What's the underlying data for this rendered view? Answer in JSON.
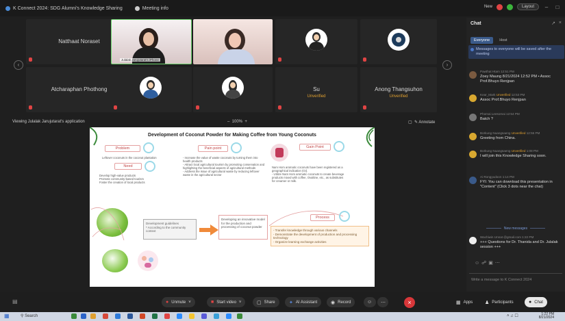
{
  "titlebar": {
    "meeting": "K Connect 2024: SDG Alumni's Knowledge Sharing",
    "info": "Meeting info",
    "new_label": "New",
    "layout_label": "Layout"
  },
  "gallery": {
    "names": {
      "t1": "Natthaat Noraset",
      "t2": "Julalak Jarujutarat's iPhone",
      "t3": "Atcharaphan Phothong",
      "t4": "Su",
      "t5": "Anong Thangsuhon"
    },
    "unverified": "Unverified"
  },
  "sharebar": {
    "viewing": "Viewing Julalak Jarujutarat's application",
    "zoom": "100%",
    "annotate": "Annotate"
  },
  "slide": {
    "title": "Development of Coconut Powder for Making Coffee from Young Coconuts",
    "problem": "Problem",
    "problem_text": "Leftover coconuts in the coconut plantation",
    "need": "Need",
    "need_text": "Develop high-value products\nPromote community-based tourism\nFoster the creation of local products",
    "pain": "Pain point",
    "pain_text": "- Increase the value of waste coconuts by turning them into health products\n- Attract local agricultural tourism by promoting conservation and highlighting the beneficial aspects of agricultural methods\n- Address the issue of agricultural waste by reducing leftover waste in the agricultural sector",
    "gain": "Gain Point",
    "gain_text": "Nam Hom aromatic coconuts have been registered as a geographical indication (GI).\n- Utilize Nam Hom aromatic coconuts to create beverage products mixed with coffee, Ovaltine, etc., as substitutes for creamer or milk.",
    "guideline": "Development guidelines\n* According to the community context",
    "model": "Developing an innovative model for the production and processing of coconut powder",
    "process": "Process",
    "process_text": "- Transfer knowledge through various channels\n- Demonstrate the development of production and processing technology\n- Organize learning exchange activities"
  },
  "chat": {
    "title": "Chat",
    "tab_everyone": "Everyone",
    "tab_host": "Host",
    "notice": "Messages to everyone will be saved after the meeting",
    "m1_meta": "Pawthat Htam 12:51 PM",
    "m1_text": "Zoey Maung 8/21/2024 12:52 PM • Assoc Prof.Bhuyo Renjpan",
    "m2_meta_name": "Kear_Mark",
    "m2_meta_time": "12:53 PM",
    "m2_text": "Assoc Prof.Bhuyo Renjpan",
    "m3_meta": "Phomai Leesomai 12:54 PM",
    "m3_text": "Batch ?",
    "m4_meta_name": "Borkung Nuangsaeng",
    "m4_meta_time": "12:55 PM",
    "m4_text": "Greeting from China.",
    "m5_meta_name": "Borkung Nuangsaeng",
    "m5_meta_time": "1:08 PM",
    "m5_text": "I will join this Knowledge Sharing soon.",
    "m6_meta": "Ai Rongyudoon 1:14 PM",
    "m6_text": "FYI: You can download this presentation in \"Content\" (Click 3 dots near the chat)",
    "new_messages": "New messages",
    "m7_meta": "Wachiwin Unnat @gmail.com 1:22 PM",
    "m7_text": "+++ Questions for Dr. Thanida and Dr. Julalak session +++",
    "input_placeholder": "Write a message to K Connect 2024"
  },
  "toolbar": {
    "unmute": "Unmute",
    "start_video": "Start video",
    "share": "Share",
    "ai_assistant": "AI Assistant",
    "record": "Record",
    "apps": "Apps",
    "participants": "Participants",
    "chat": "Chat"
  },
  "taskbar": {
    "search": "Search",
    "time": "1:22 PM",
    "date": "8/21/2024"
  }
}
